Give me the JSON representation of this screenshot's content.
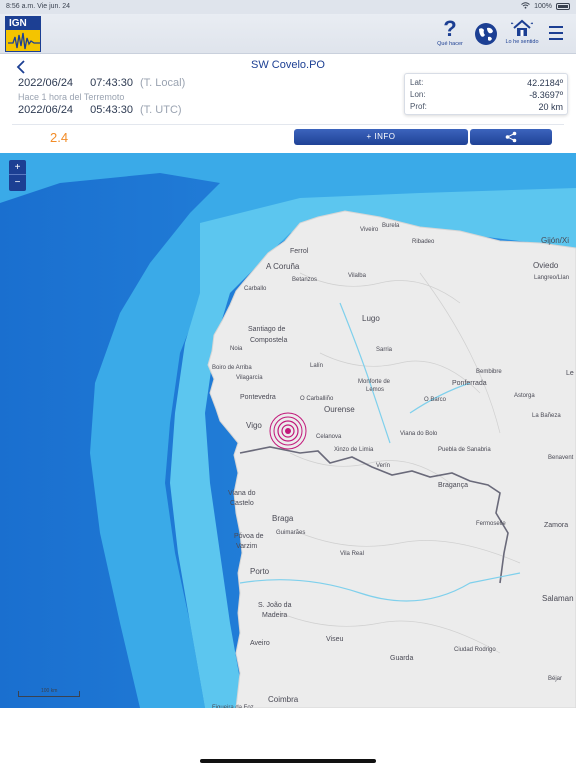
{
  "status_bar": {
    "time": "8:56 a.m.  Vie jun. 24",
    "battery": "100%"
  },
  "header": {
    "logo_text": "IGN",
    "que_hacer_label": "Qué hacer",
    "lo_he_sentido_label": "Lo he sentido",
    "icons": [
      "question-mark-icon",
      "globe-icon",
      "house-quake-icon",
      "menu-icon"
    ]
  },
  "event": {
    "place": "SW Covelo.PO",
    "local_date": "2022/06/24",
    "local_time": "07:43:30",
    "local_tz": "(T. Local)",
    "ago": "Hace 1 hora del Terremoto",
    "utc_date": "2022/06/24",
    "utc_time": "05:43:30",
    "utc_tz": "(T. UTC)",
    "magnitude": "2.4",
    "magnitude_color": "#f28c28"
  },
  "coords": {
    "lat_label": "Lat:",
    "lat_value": "42.2184º",
    "lon_label": "Lon:",
    "lon_value": "-8.3697º",
    "depth_label": "Prof:",
    "depth_value": "20 km"
  },
  "actions": {
    "info_label": "+ INFO",
    "share_icon": "share-icon"
  },
  "map": {
    "zoom_in": "+",
    "zoom_out": "−",
    "scale_label": "100 km",
    "colors": {
      "ocean_deep": "#1f78d6",
      "ocean_shelf": "#55c5ee",
      "land": "#eeeeee",
      "border": "#6a6a7a",
      "epicenter": "#c2187a"
    },
    "places": [
      {
        "name": "Burela"
      },
      {
        "name": "Viveiro"
      },
      {
        "name": "Ribadeo"
      },
      {
        "name": "Gijón/Xi"
      },
      {
        "name": "Ferrol"
      },
      {
        "name": "Oviedo"
      },
      {
        "name": "Langreo/Llan"
      },
      {
        "name": "A Coruña"
      },
      {
        "name": "Betanzos"
      },
      {
        "name": "Vilalba"
      },
      {
        "name": "Carballo"
      },
      {
        "name": "Lugo"
      },
      {
        "name": "Santiago de"
      },
      {
        "name": "Compostela"
      },
      {
        "name": "Noia"
      },
      {
        "name": "Sarria"
      },
      {
        "name": "Lalín"
      },
      {
        "name": "Boiro de Arriba"
      },
      {
        "name": "Vilagarcía"
      },
      {
        "name": "Monforte de"
      },
      {
        "name": "Lemos"
      },
      {
        "name": "Bembibre"
      },
      {
        "name": "Ponferrada"
      },
      {
        "name": "Pontevedra"
      },
      {
        "name": "O Carballiño"
      },
      {
        "name": "Ourense"
      },
      {
        "name": "Astorga"
      },
      {
        "name": "O Barco"
      },
      {
        "name": "La Bañeza"
      },
      {
        "name": "Vigo"
      },
      {
        "name": "Celanova"
      },
      {
        "name": "Viana do Bolo"
      },
      {
        "name": "Xinzo de Limia"
      },
      {
        "name": "Puebla de Sanabria"
      },
      {
        "name": "Benavent"
      },
      {
        "name": "Verín"
      },
      {
        "name": "Bragança"
      },
      {
        "name": "Viana do"
      },
      {
        "name": "Castelo"
      },
      {
        "name": "Braga"
      },
      {
        "name": "Guimarães"
      },
      {
        "name": "Zamora"
      },
      {
        "name": "Póvoa de"
      },
      {
        "name": "Varzim"
      },
      {
        "name": "Vila Real"
      },
      {
        "name": "Fermoselle"
      },
      {
        "name": "Porto"
      },
      {
        "name": "S. João da"
      },
      {
        "name": "Madeira"
      },
      {
        "name": "Salaman"
      },
      {
        "name": "Aveiro"
      },
      {
        "name": "Viseu"
      },
      {
        "name": "Guarda"
      },
      {
        "name": "Ciudad Rodrigo"
      },
      {
        "name": "Béjar"
      },
      {
        "name": "Coimbra"
      },
      {
        "name": "Figueira da Foz"
      },
      {
        "name": "Le"
      },
      {
        "name": "León"
      }
    ]
  }
}
